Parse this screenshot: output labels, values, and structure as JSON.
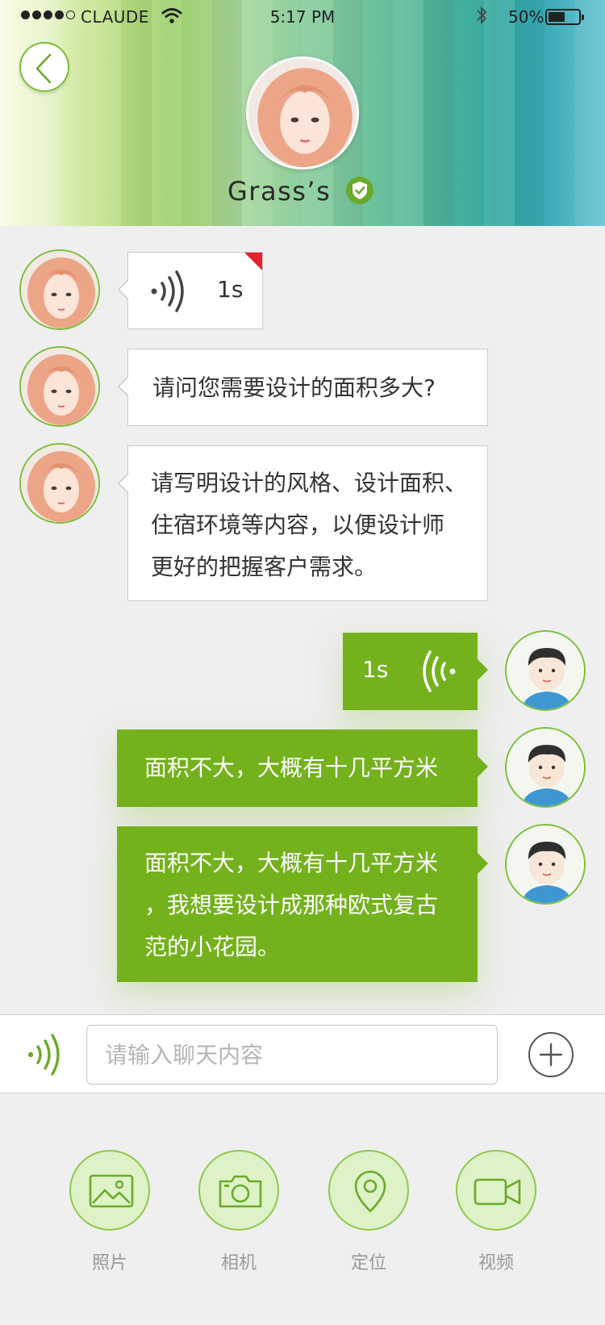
{
  "status_bar": {
    "carrier": "CLAUDE",
    "time": "5:17 PM",
    "battery": "50%",
    "battery_level": 0.5
  },
  "header": {
    "back_icon": "chevron-left-icon",
    "contact_name": "Grass’s",
    "verified_icon": "shield-check-icon"
  },
  "messages": [
    {
      "side": "left",
      "type": "voice",
      "duration": "1s",
      "unread": true
    },
    {
      "side": "left",
      "type": "text",
      "text": "请问您需要设计的面积多大?"
    },
    {
      "side": "left",
      "type": "text",
      "lines": [
        "请写明设计的风格、设计面积、",
        "住宿环境等内容，以便设计师",
        "更好的把握客户需求。"
      ]
    },
    {
      "side": "right",
      "type": "voice",
      "duration": "1s"
    },
    {
      "side": "right",
      "type": "text",
      "text": "面积不大，大概有十几平方米"
    },
    {
      "side": "right",
      "type": "text",
      "lines": [
        "面积不大，大概有十几平方米",
        "，我想要设计成那种欧式复古",
        "范的小花园。"
      ]
    }
  ],
  "input_bar": {
    "placeholder": "请输入聊天内容",
    "mic_icon": "voice-icon",
    "plus_icon": "plus-circle-icon"
  },
  "tools": [
    {
      "label": "照片",
      "icon": "photo-icon"
    },
    {
      "label": "相机",
      "icon": "camera-icon"
    },
    {
      "label": "定位",
      "icon": "location-pin-icon"
    },
    {
      "label": "视频",
      "icon": "video-icon"
    }
  ],
  "colors": {
    "accent_green": "#74b21d",
    "tool_bg": "#ddf2c6",
    "unread_red": "#e3222c",
    "background": "#efefef"
  }
}
